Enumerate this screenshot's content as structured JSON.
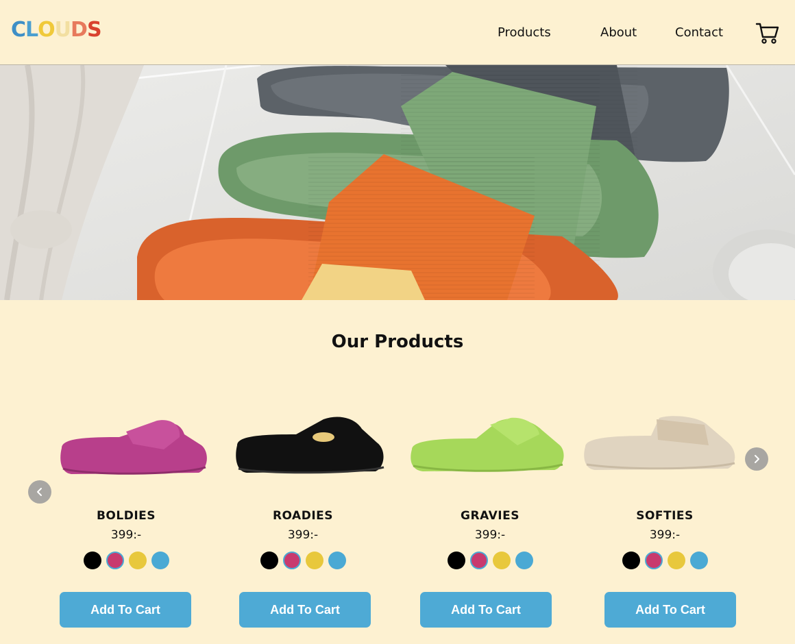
{
  "logo": {
    "text": "CLOUDS",
    "letters": [
      {
        "ch": "C",
        "color": "#3e8fc6"
      },
      {
        "ch": "L",
        "color": "#4a9fd0"
      },
      {
        "ch": "O",
        "color": "#f0c93a"
      },
      {
        "ch": "U",
        "color": "#f2dfa1"
      },
      {
        "ch": "D",
        "color": "#e77a5c"
      },
      {
        "ch": "S",
        "color": "#d9422e"
      }
    ]
  },
  "nav": {
    "products": "Products",
    "about": "About",
    "contact": "Contact"
  },
  "hero": {
    "alt": "slide sandals"
  },
  "section": {
    "title": "Our Products"
  },
  "products": [
    {
      "name": "BOLDIES",
      "price": "399:-",
      "color": "#b83f8b",
      "cta": "Add To Cart"
    },
    {
      "name": "ROADIES",
      "price": "399:-",
      "color": "#111111",
      "cta": "Add To Cart"
    },
    {
      "name": "GRAVIES",
      "price": "399:-",
      "color": "#a6d85a",
      "cta": "Add To Cart"
    },
    {
      "name": "SOFTIES",
      "price": "399:-",
      "color": "#e0d4c0",
      "cta": "Add To Cart"
    }
  ],
  "swatch_colors": [
    "#000000",
    "#c83a6e",
    "#e8c83c",
    "#4aa9d4"
  ],
  "selected_swatch": 1,
  "colors": {
    "background": "#fdf1d1",
    "accent": "#4eaad5"
  }
}
